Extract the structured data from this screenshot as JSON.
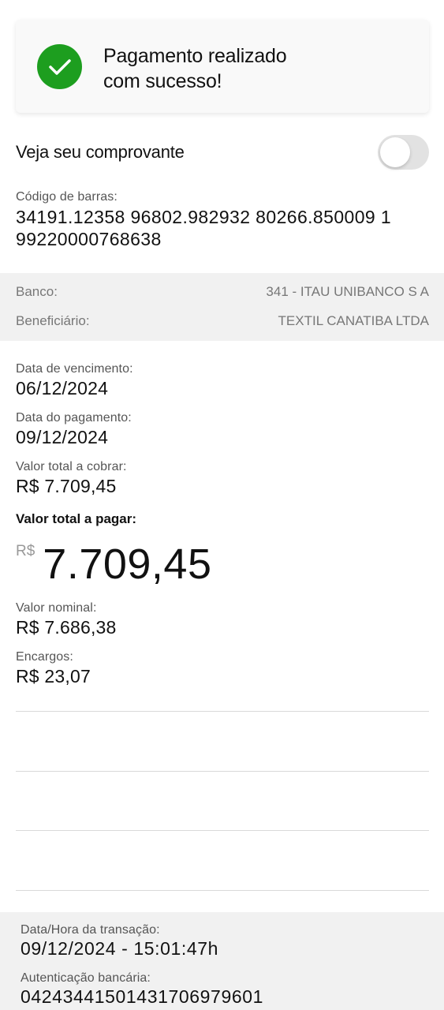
{
  "success": {
    "message": "Pagamento realizado\ncom sucesso!",
    "icon": "check-icon",
    "color": "#1d9e1f"
  },
  "receipt": {
    "label": "Veja seu comprovante",
    "toggle_on": false
  },
  "barcode": {
    "label": "Código de barras:",
    "value": "34191.12358 96802.982932 80266.850009 1 99220000768638"
  },
  "bank": {
    "bank_label": "Banco:",
    "bank_value": "341 - ITAU UNIBANCO S A",
    "beneficiary_label": "Beneficiário:",
    "beneficiary_value": "TEXTIL CANATIBA LTDA"
  },
  "details": {
    "due_date_label": "Data de vencimento:",
    "due_date_value": "06/12/2024",
    "payment_date_label": "Data do pagamento:",
    "payment_date_value": "09/12/2024",
    "total_charge_label": "Valor total a cobrar:",
    "total_charge_value": "R$  7.709,45",
    "total_pay_label": "Valor total a pagar:",
    "total_pay_currency": "R$",
    "total_pay_value": "7.709,45",
    "nominal_label": "Valor nominal:",
    "nominal_value": "R$  7.686,38",
    "charges_label": "Encargos:",
    "charges_value": "R$  23,07"
  },
  "transaction": {
    "datetime_label": "Data/Hora da transação:",
    "datetime_value": "09/12/2024 - 15:01:47h",
    "auth_label": "Autenticação bancária:",
    "auth_value": "042434415014317069796​01"
  }
}
